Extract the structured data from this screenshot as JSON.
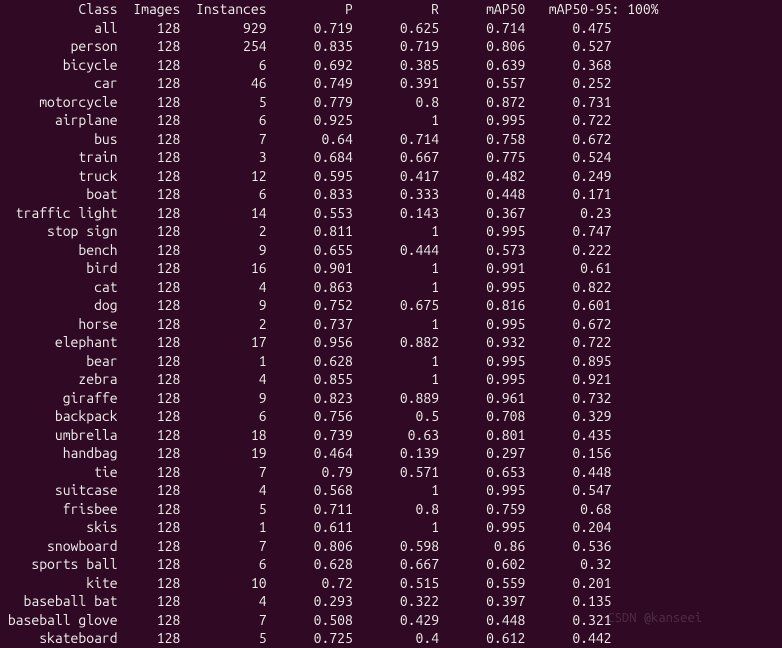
{
  "header": {
    "class": "Class",
    "images": "Images",
    "instances": "Instances",
    "p": "P",
    "r": "R",
    "map50": "mAP50",
    "map5095": "mAP50-95",
    "progress": ": 100%"
  },
  "chart_data": {
    "type": "table",
    "columns": [
      "Class",
      "Images",
      "Instances",
      "P",
      "R",
      "mAP50",
      "mAP50-95"
    ],
    "rows": [
      {
        "class": "all",
        "images": 128,
        "instances": 929,
        "p": 0.719,
        "r": 0.625,
        "map50": 0.714,
        "map5095": 0.475
      },
      {
        "class": "person",
        "images": 128,
        "instances": 254,
        "p": 0.835,
        "r": 0.719,
        "map50": 0.806,
        "map5095": 0.527
      },
      {
        "class": "bicycle",
        "images": 128,
        "instances": 6,
        "p": 0.692,
        "r": 0.385,
        "map50": 0.639,
        "map5095": 0.368
      },
      {
        "class": "car",
        "images": 128,
        "instances": 46,
        "p": 0.749,
        "r": 0.391,
        "map50": 0.557,
        "map5095": 0.252
      },
      {
        "class": "motorcycle",
        "images": 128,
        "instances": 5,
        "p": 0.779,
        "r": 0.8,
        "map50": 0.872,
        "map5095": 0.731
      },
      {
        "class": "airplane",
        "images": 128,
        "instances": 6,
        "p": 0.925,
        "r": 1,
        "map50": 0.995,
        "map5095": 0.722
      },
      {
        "class": "bus",
        "images": 128,
        "instances": 7,
        "p": 0.64,
        "r": 0.714,
        "map50": 0.758,
        "map5095": 0.672
      },
      {
        "class": "train",
        "images": 128,
        "instances": 3,
        "p": 0.684,
        "r": 0.667,
        "map50": 0.775,
        "map5095": 0.524
      },
      {
        "class": "truck",
        "images": 128,
        "instances": 12,
        "p": 0.595,
        "r": 0.417,
        "map50": 0.482,
        "map5095": 0.249
      },
      {
        "class": "boat",
        "images": 128,
        "instances": 6,
        "p": 0.833,
        "r": 0.333,
        "map50": 0.448,
        "map5095": 0.171
      },
      {
        "class": "traffic light",
        "images": 128,
        "instances": 14,
        "p": 0.553,
        "r": 0.143,
        "map50": 0.367,
        "map5095": 0.23
      },
      {
        "class": "stop sign",
        "images": 128,
        "instances": 2,
        "p": 0.811,
        "r": 1,
        "map50": 0.995,
        "map5095": 0.747
      },
      {
        "class": "bench",
        "images": 128,
        "instances": 9,
        "p": 0.655,
        "r": 0.444,
        "map50": 0.573,
        "map5095": 0.222
      },
      {
        "class": "bird",
        "images": 128,
        "instances": 16,
        "p": 0.901,
        "r": 1,
        "map50": 0.991,
        "map5095": 0.61
      },
      {
        "class": "cat",
        "images": 128,
        "instances": 4,
        "p": 0.863,
        "r": 1,
        "map50": 0.995,
        "map5095": 0.822
      },
      {
        "class": "dog",
        "images": 128,
        "instances": 9,
        "p": 0.752,
        "r": 0.675,
        "map50": 0.816,
        "map5095": 0.601
      },
      {
        "class": "horse",
        "images": 128,
        "instances": 2,
        "p": 0.737,
        "r": 1,
        "map50": 0.995,
        "map5095": 0.672
      },
      {
        "class": "elephant",
        "images": 128,
        "instances": 17,
        "p": 0.956,
        "r": 0.882,
        "map50": 0.932,
        "map5095": 0.722
      },
      {
        "class": "bear",
        "images": 128,
        "instances": 1,
        "p": 0.628,
        "r": 1,
        "map50": 0.995,
        "map5095": 0.895
      },
      {
        "class": "zebra",
        "images": 128,
        "instances": 4,
        "p": 0.855,
        "r": 1,
        "map50": 0.995,
        "map5095": 0.921
      },
      {
        "class": "giraffe",
        "images": 128,
        "instances": 9,
        "p": 0.823,
        "r": 0.889,
        "map50": 0.961,
        "map5095": 0.732
      },
      {
        "class": "backpack",
        "images": 128,
        "instances": 6,
        "p": 0.756,
        "r": 0.5,
        "map50": 0.708,
        "map5095": 0.329
      },
      {
        "class": "umbrella",
        "images": 128,
        "instances": 18,
        "p": 0.739,
        "r": 0.63,
        "map50": 0.801,
        "map5095": 0.435
      },
      {
        "class": "handbag",
        "images": 128,
        "instances": 19,
        "p": 0.464,
        "r": 0.139,
        "map50": 0.297,
        "map5095": 0.156
      },
      {
        "class": "tie",
        "images": 128,
        "instances": 7,
        "p": 0.79,
        "r": 0.571,
        "map50": 0.653,
        "map5095": 0.448
      },
      {
        "class": "suitcase",
        "images": 128,
        "instances": 4,
        "p": 0.568,
        "r": 1,
        "map50": 0.995,
        "map5095": 0.547
      },
      {
        "class": "frisbee",
        "images": 128,
        "instances": 5,
        "p": 0.711,
        "r": 0.8,
        "map50": 0.759,
        "map5095": 0.68
      },
      {
        "class": "skis",
        "images": 128,
        "instances": 1,
        "p": 0.611,
        "r": 1,
        "map50": 0.995,
        "map5095": 0.204
      },
      {
        "class": "snowboard",
        "images": 128,
        "instances": 7,
        "p": 0.806,
        "r": 0.598,
        "map50": 0.86,
        "map5095": 0.536
      },
      {
        "class": "sports ball",
        "images": 128,
        "instances": 6,
        "p": 0.628,
        "r": 0.667,
        "map50": 0.602,
        "map5095": 0.32
      },
      {
        "class": "kite",
        "images": 128,
        "instances": 10,
        "p": 0.72,
        "r": 0.515,
        "map50": 0.559,
        "map5095": 0.201
      },
      {
        "class": "baseball bat",
        "images": 128,
        "instances": 4,
        "p": 0.293,
        "r": 0.322,
        "map50": 0.397,
        "map5095": 0.135
      },
      {
        "class": "baseball glove",
        "images": 128,
        "instances": 7,
        "p": 0.508,
        "r": 0.429,
        "map50": 0.448,
        "map5095": 0.321
      },
      {
        "class": "skateboard",
        "images": 128,
        "instances": 5,
        "p": 0.725,
        "r": 0.4,
        "map50": 0.612,
        "map5095": 0.442
      }
    ]
  },
  "watermark": "CSDN @kanseei"
}
